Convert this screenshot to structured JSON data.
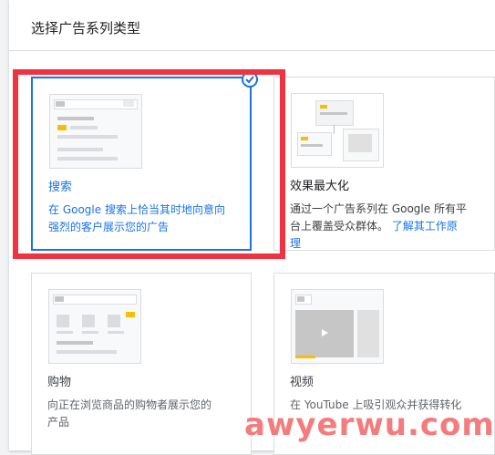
{
  "panel": {
    "title": "选择广告系列类型"
  },
  "cards": {
    "search": {
      "title": "搜索",
      "desc_line1": "在 Google 搜索上恰当其时地向意向",
      "desc_line2": "强烈的客户展示您的广告",
      "selected": true
    },
    "pmax": {
      "title": "效果最大化",
      "desc_line1": "通过一个广告系列在 Google 所有平",
      "desc_line2_prefix": "台上覆盖受众群体。",
      "link_part1": "了解其工作原",
      "link_part2": "理"
    },
    "shopping": {
      "title": "购物",
      "desc_line1": "向正在浏览商品的购物者展示您的",
      "desc_line2": "产品"
    },
    "video": {
      "title": "视频",
      "desc_line1": "在 YouTube 上吸引观众并获得转化"
    }
  },
  "colors": {
    "accent": "#1a73e8",
    "highlight": "#ef3340",
    "yellow": "#fbbc04"
  },
  "watermark": "awyerwu.com"
}
